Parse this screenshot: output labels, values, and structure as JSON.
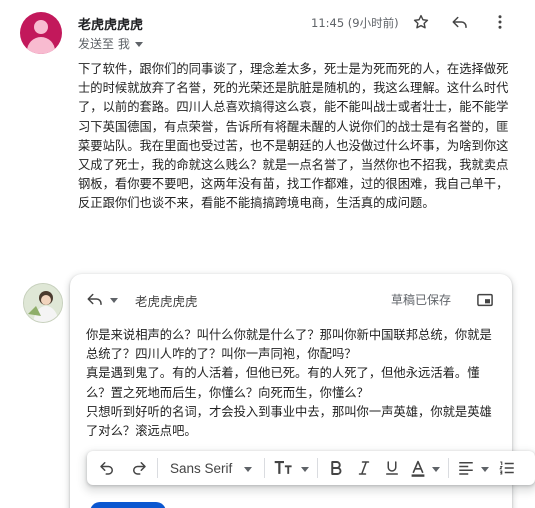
{
  "message": {
    "sender": "老虎虎虎虎",
    "to_label": "发送至 我",
    "time": "11:45 (9小时前)",
    "body": "下了软件，跟你们的同事谈了，理念差太多，死士是为死而死的人，在选择做死士的时候就放弃了名誉，死的光荣还是肮脏是随机的，我这么理解。这什么时代了，以前的套路。四川人总喜欢搞得这么哀，能不能叫战士或者壮士，能不能学习下英国德国，有点荣誉，告诉所有将醒未醒的人说你们的战士是有名誉的，匪菜要站队。我在里面也受过苦，也不是朝廷的人也没做过什么坏事，为啥到你这又成了死士，我的命就这么贱么？就是一点名誉了，当然你也不招我，我就卖点钢板，看你要不要吧，这两年没有苗，找工作都难，过的很困难，我自己单干，反正跟你们也谈不来，看能不能搞搞跨境电商，生活真的成问题。"
  },
  "icons": {
    "star": "star-icon",
    "reply": "reply-icon",
    "more": "more-vert-icon"
  },
  "reply": {
    "to": "老虎虎虎虎",
    "status": "草稿已保存",
    "body_lines": [
      "你是来说相声的么？叫什么你就是什么了？那叫你新中国联邦总统，你就是总统了？四川人咋的了？叫你一声同袍，你配吗？",
      "真是遇到鬼了。有的人活着，但他已死。有的人死了，但他永远活着。懂么？置之死地而后生，你懂么？向死而生，你懂么？",
      "只想听到好听的名词，才会投入到事业中去，那叫你一声英雄，你就是英雄了对么？滚远点吧。"
    ]
  },
  "toolbar": {
    "font": "Sans Serif",
    "items": [
      "undo",
      "redo",
      "font-family",
      "font-size",
      "bold",
      "italic",
      "underline",
      "text-color",
      "align",
      "numbered-list"
    ]
  },
  "colors": {
    "avatar": "#c2185b",
    "send_button": "#0b57d0"
  }
}
